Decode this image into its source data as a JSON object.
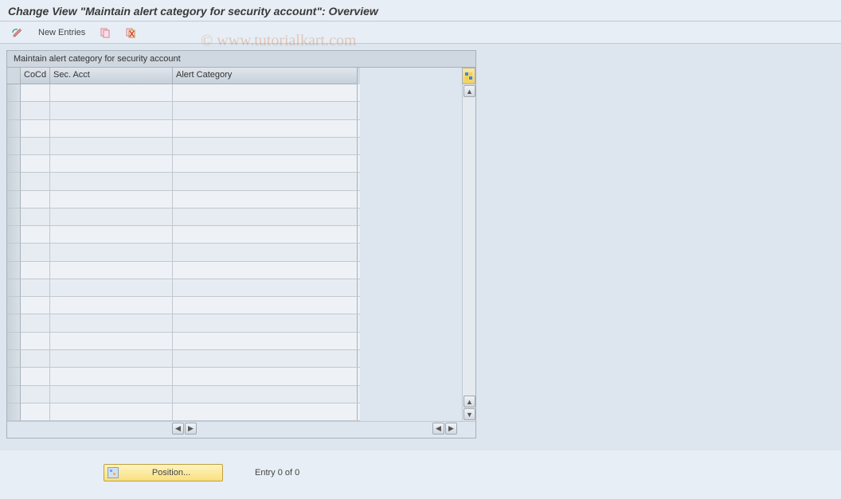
{
  "title": "Change View \"Maintain alert category for security account\": Overview",
  "toolbar": {
    "new_entries": "New Entries"
  },
  "panel": {
    "title": "Maintain alert category for security account",
    "columns": {
      "cocd": "CoCd",
      "sec_acct": "Sec. Acct",
      "alert_category": "Alert Category"
    },
    "rows": [
      {
        "cocd": "",
        "sec_acct": "",
        "alert_category": ""
      },
      {
        "cocd": "",
        "sec_acct": "",
        "alert_category": ""
      },
      {
        "cocd": "",
        "sec_acct": "",
        "alert_category": ""
      },
      {
        "cocd": "",
        "sec_acct": "",
        "alert_category": ""
      },
      {
        "cocd": "",
        "sec_acct": "",
        "alert_category": ""
      },
      {
        "cocd": "",
        "sec_acct": "",
        "alert_category": ""
      },
      {
        "cocd": "",
        "sec_acct": "",
        "alert_category": ""
      },
      {
        "cocd": "",
        "sec_acct": "",
        "alert_category": ""
      },
      {
        "cocd": "",
        "sec_acct": "",
        "alert_category": ""
      },
      {
        "cocd": "",
        "sec_acct": "",
        "alert_category": ""
      },
      {
        "cocd": "",
        "sec_acct": "",
        "alert_category": ""
      },
      {
        "cocd": "",
        "sec_acct": "",
        "alert_category": ""
      },
      {
        "cocd": "",
        "sec_acct": "",
        "alert_category": ""
      },
      {
        "cocd": "",
        "sec_acct": "",
        "alert_category": ""
      },
      {
        "cocd": "",
        "sec_acct": "",
        "alert_category": ""
      },
      {
        "cocd": "",
        "sec_acct": "",
        "alert_category": ""
      },
      {
        "cocd": "",
        "sec_acct": "",
        "alert_category": ""
      },
      {
        "cocd": "",
        "sec_acct": "",
        "alert_category": ""
      },
      {
        "cocd": "",
        "sec_acct": "",
        "alert_category": ""
      }
    ]
  },
  "footer": {
    "position_label": "Position...",
    "entry_text": "Entry 0 of 0"
  },
  "watermark": "© www.tutorialkart.com"
}
